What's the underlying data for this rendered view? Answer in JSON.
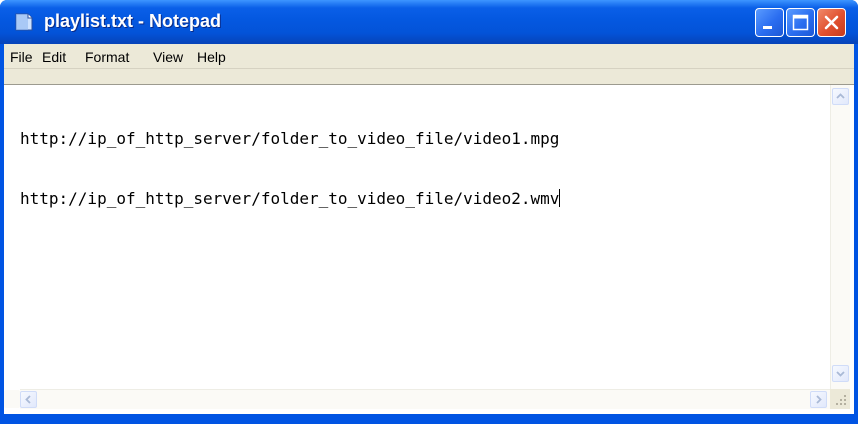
{
  "window": {
    "title": "playlist.txt - Notepad",
    "accent": "#0054e3"
  },
  "caption_buttons": {
    "minimize_icon": "minimize-icon",
    "maximize_icon": "maximize-icon",
    "close_icon": "close-icon"
  },
  "menu": {
    "items": [
      {
        "label": "File"
      },
      {
        "label": "Edit"
      },
      {
        "label": "Format"
      },
      {
        "label": "View"
      },
      {
        "label": "Help"
      }
    ]
  },
  "editor": {
    "lines": [
      "http://ip_of_http_server/folder_to_video_file/video1.mpg",
      "http://ip_of_http_server/folder_to_video_file/video2.wmv"
    ]
  }
}
